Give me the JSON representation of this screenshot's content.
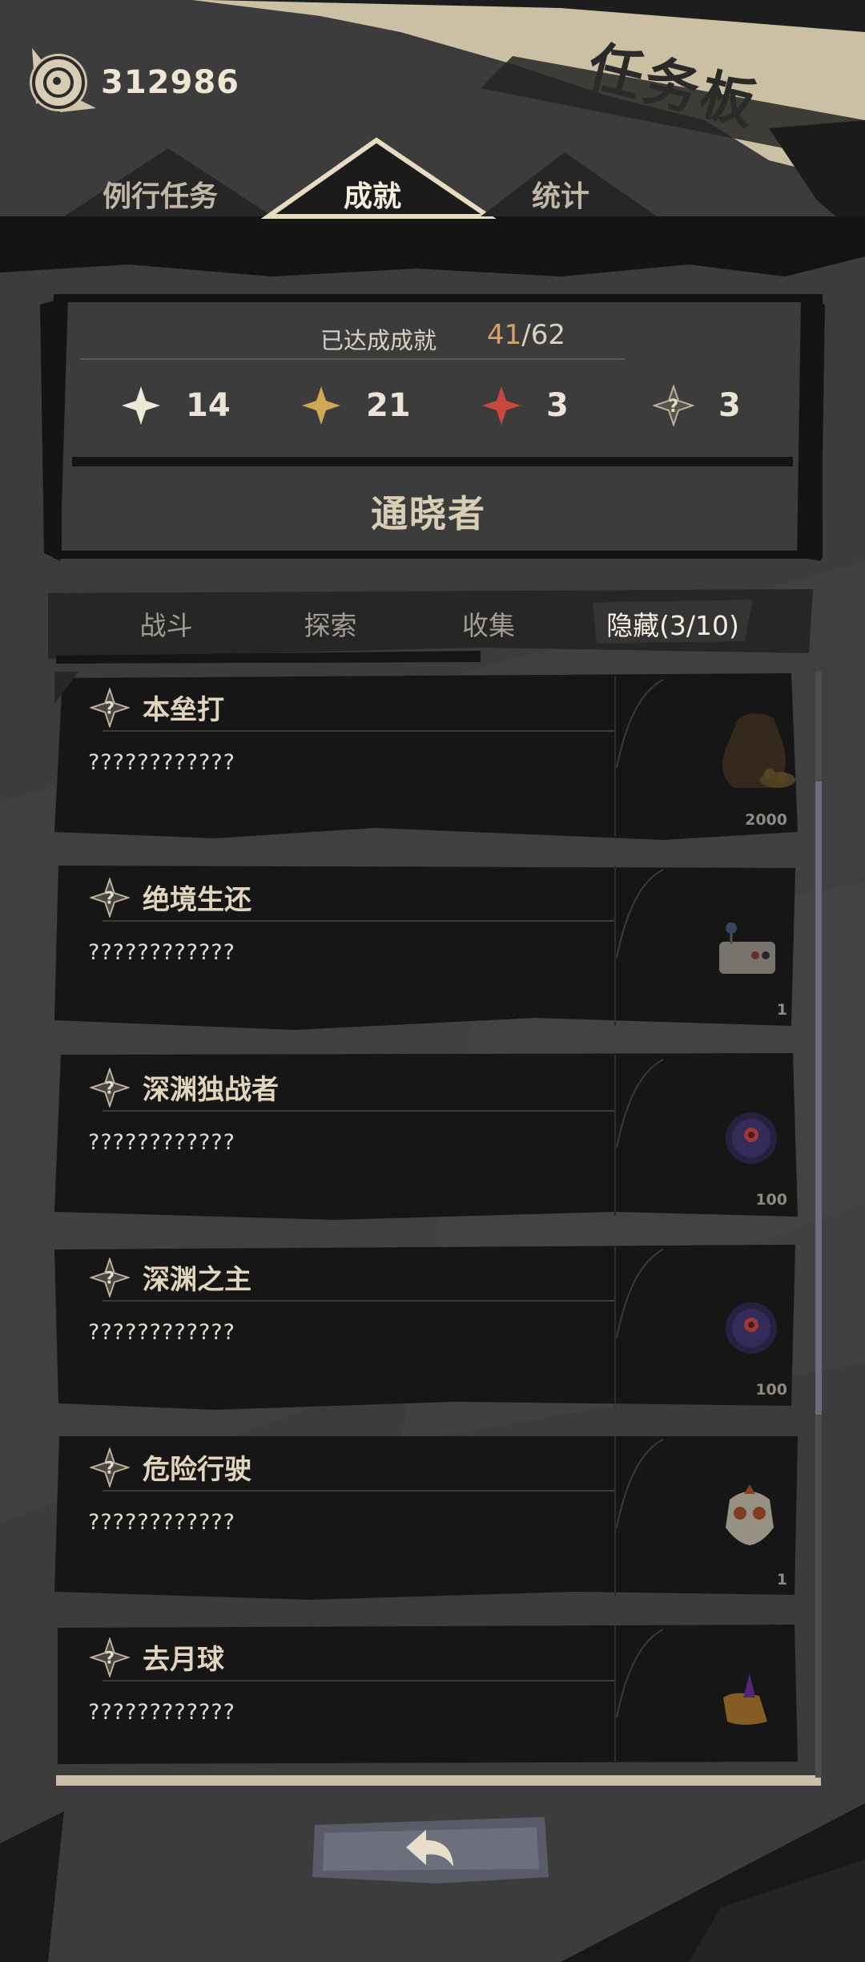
{
  "currency": {
    "amount": "312986",
    "icon": "coin-icon"
  },
  "board_title": "任务板",
  "tabs": [
    {
      "label": "例行任务",
      "active": false
    },
    {
      "label": "成就",
      "active": true
    },
    {
      "label": "统计",
      "active": false
    }
  ],
  "summary": {
    "label": "已达成成就",
    "current": "41",
    "separator": "/",
    "total": "62",
    "stats": [
      {
        "icon": "white-star-icon",
        "count": "14",
        "color": "#efe8d8"
      },
      {
        "icon": "gold-star-icon",
        "count": "21",
        "color": "#cfa853"
      },
      {
        "icon": "red-star-icon",
        "count": "3",
        "color": "#c8483e"
      },
      {
        "icon": "hidden-achievement-icon",
        "count": "3",
        "color": "#9c9584"
      }
    ],
    "honor_title": "通晓者"
  },
  "categories": [
    {
      "label": "战斗",
      "active": false
    },
    {
      "label": "探索",
      "active": false
    },
    {
      "label": "收集",
      "active": false
    },
    {
      "label": "隐藏",
      "progress": "(3/10)",
      "active": true
    }
  ],
  "achievements": [
    {
      "title": "本垒打",
      "description": "????????????",
      "reward_icon": "coin-bag-icon",
      "reward_count": "2000"
    },
    {
      "title": "绝境生还",
      "description": "????????????",
      "reward_icon": "device-icon",
      "reward_count": "1"
    },
    {
      "title": "深渊独战者",
      "description": "????????????",
      "reward_icon": "purple-orb-icon",
      "reward_count": "100"
    },
    {
      "title": "深渊之主",
      "description": "????????????",
      "reward_icon": "purple-orb-icon",
      "reward_count": "100"
    },
    {
      "title": "危险行驶",
      "description": "????????????",
      "reward_icon": "skull-mask-icon",
      "reward_count": "1"
    },
    {
      "title": "去月球",
      "description": "????????????",
      "reward_icon": "scroll-icon",
      "reward_count": ""
    }
  ],
  "back_button": {
    "icon": "back-arrow-icon"
  }
}
